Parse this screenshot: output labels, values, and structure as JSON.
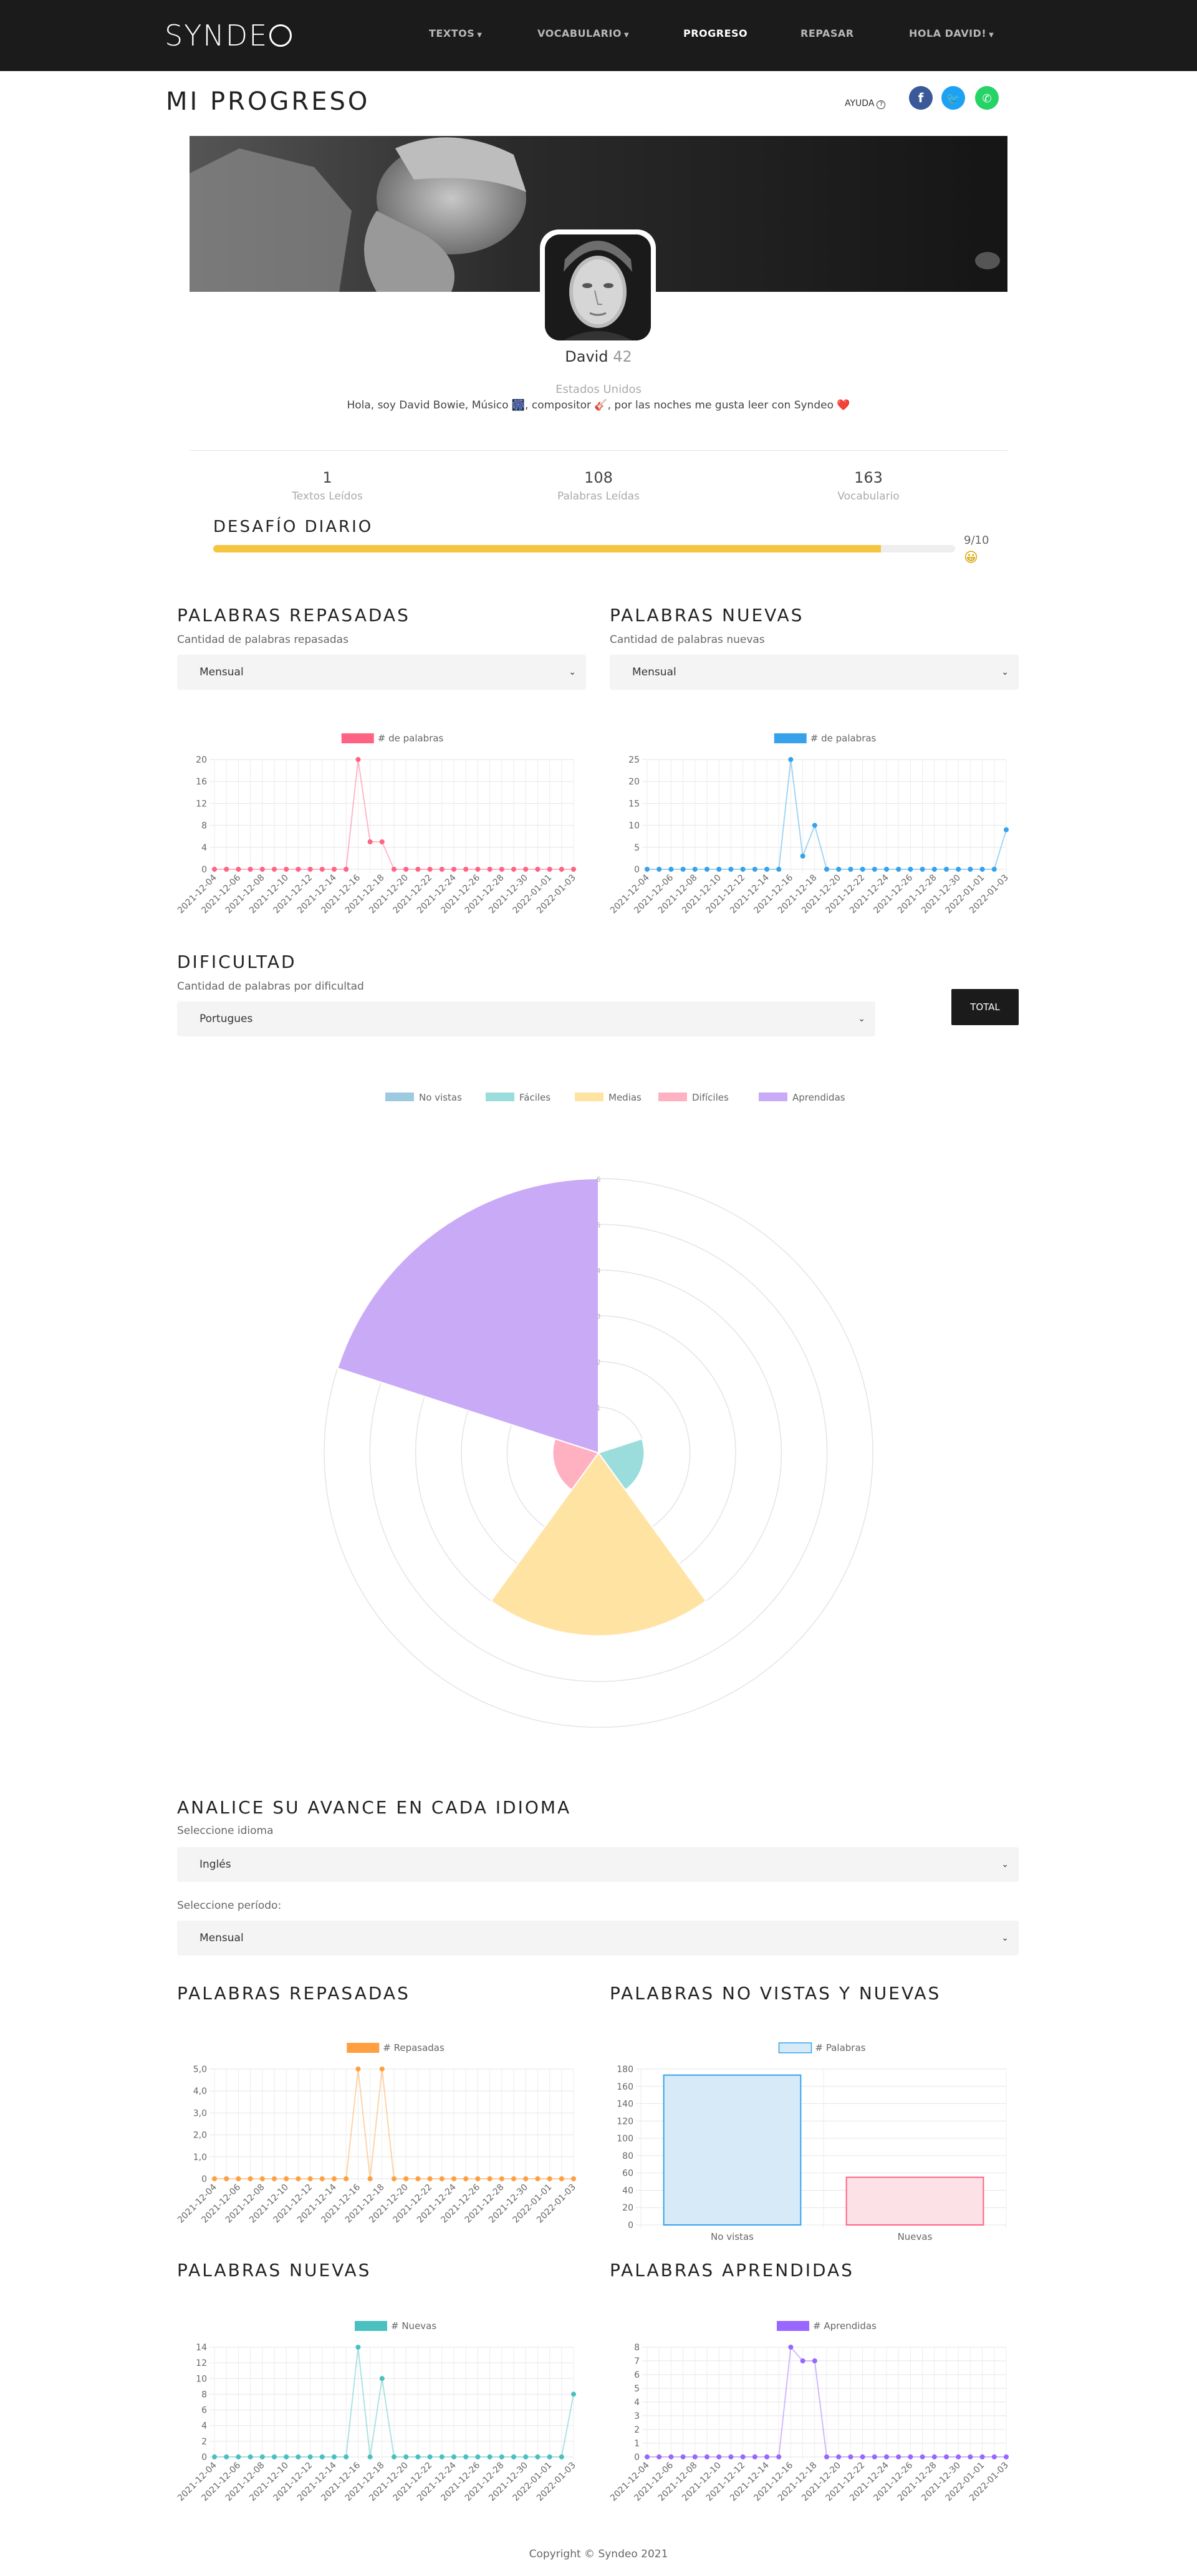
{
  "nav": {
    "brand": "SYNDE",
    "items": [
      {
        "label": "TEXTOS",
        "dropdown": true
      },
      {
        "label": "VOCABULARIO",
        "dropdown": true
      },
      {
        "label": "PROGRESO",
        "dropdown": false,
        "active": true
      },
      {
        "label": "REPASAR",
        "dropdown": false
      },
      {
        "label": "HOLA DAVID!",
        "dropdown": true
      }
    ]
  },
  "header": {
    "title": "MI PROGRESO",
    "help": "AYUDA"
  },
  "social": [
    {
      "name": "facebook",
      "glyph": "f",
      "color": "#3b5998"
    },
    {
      "name": "twitter",
      "glyph": "t",
      "color": "#1da1f2"
    },
    {
      "name": "whatsapp",
      "glyph": "w",
      "color": "#25d366"
    }
  ],
  "profile": {
    "name": "David",
    "age": "42",
    "country": "Estados Unidos",
    "bio": "Hola, soy David Bowie, Músico 🎆, compositor 🎸, por las noches me gusta leer con Syndeo ❤️"
  },
  "stats": [
    {
      "value": "1",
      "label": "Textos Leídos"
    },
    {
      "value": "108",
      "label": "Palabras Leídas"
    },
    {
      "value": "163",
      "label": "Vocabulario"
    }
  ],
  "challenge": {
    "title": "DESAFÍO DIARIO",
    "text": "9/10",
    "fraction": 0.9,
    "emoji": "😀"
  },
  "repasadas": {
    "title": "PALABRAS REPASADAS",
    "subtitle": "Cantidad de palabras repasadas",
    "select": "Mensual"
  },
  "nuevas": {
    "title": "PALABRAS NUEVAS",
    "subtitle": "Cantidad de palabras nuevas",
    "select": "Mensual"
  },
  "dificultad": {
    "title": "DIFICULTAD",
    "subtitle": "Cantidad de palabras por dificultad",
    "select": "Portugues",
    "button": "TOTAL"
  },
  "idioma": {
    "title": "ANALICE SU AVANCE EN CADA IDIOMA",
    "language_label": "Seleccione idioma",
    "language": "Inglés",
    "period_label": "Seleccione período:",
    "period": "Mensual"
  },
  "sections2": {
    "repasadas": "PALABRAS REPASADAS",
    "novistas": "PALABRAS NO VISTAS Y NUEVAS",
    "nuevas": "PALABRAS NUEVAS",
    "aprendidas": "PALABRAS APRENDIDAS"
  },
  "footer": "Copyright © Syndeo 2021",
  "chart_data": [
    {
      "id": "c1",
      "type": "line",
      "series": [
        {
          "name": "# de palabras",
          "color": "#ff6384",
          "values": [
            0,
            0,
            0,
            0,
            0,
            0,
            0,
            0,
            0,
            0,
            0,
            0,
            20,
            5,
            5,
            0,
            0,
            0,
            0,
            0,
            0,
            0,
            0,
            0,
            0,
            0,
            0,
            0,
            0,
            0,
            0
          ]
        }
      ],
      "x_tick_labels": [
        "2021-12-04",
        "2021-12-06",
        "2021-12-08",
        "2021-12-10",
        "2021-12-12",
        "2021-12-14",
        "2021-12-16",
        "2021-12-18",
        "2021-12-20",
        "2021-12-22",
        "2021-12-24",
        "2021-12-26",
        "2021-12-28",
        "2021-12-30",
        "2022-01-01",
        "2022-01-03"
      ],
      "y_ticks": [
        "0",
        "4",
        "8",
        "12",
        "16",
        "20"
      ],
      "ylim": [
        0,
        20
      ]
    },
    {
      "id": "c2",
      "type": "line",
      "series": [
        {
          "name": "# de palabras",
          "color": "#36a2eb",
          "values": [
            0,
            0,
            0,
            0,
            0,
            0,
            0,
            0,
            0,
            0,
            0,
            0,
            25,
            3,
            10,
            0,
            0,
            0,
            0,
            0,
            0,
            0,
            0,
            0,
            0,
            0,
            0,
            0,
            0,
            0,
            9
          ]
        }
      ],
      "x_tick_labels": [
        "2021-12-04",
        "2021-12-06",
        "2021-12-08",
        "2021-12-10",
        "2021-12-12",
        "2021-12-14",
        "2021-12-16",
        "2021-12-18",
        "2021-12-20",
        "2021-12-22",
        "2021-12-24",
        "2021-12-26",
        "2021-12-28",
        "2021-12-30",
        "2022-01-01",
        "2022-01-03"
      ],
      "y_ticks": [
        "0",
        "5",
        "10",
        "15",
        "20",
        "25"
      ],
      "ylim": [
        0,
        25
      ]
    },
    {
      "id": "c3",
      "type": "polarArea",
      "categories": [
        "No vistas",
        "Fáciles",
        "Medias",
        "Difíciles",
        "Aprendidas"
      ],
      "values": [
        0,
        1,
        4,
        1,
        6
      ],
      "colors": [
        "#9ecae1",
        "#9bdcdc",
        "#ffe3a3",
        "#ffb1c1",
        "#c9aaf7"
      ],
      "rmax": 6
    },
    {
      "id": "c4",
      "type": "line",
      "series": [
        {
          "name": "# Repasadas",
          "color": "#ff9f40",
          "values": [
            0,
            0,
            0,
            0,
            0,
            0,
            0,
            0,
            0,
            0,
            0,
            0,
            5,
            0,
            5,
            0,
            0,
            0,
            0,
            0,
            0,
            0,
            0,
            0,
            0,
            0,
            0,
            0,
            0,
            0,
            0
          ]
        }
      ],
      "x_tick_labels": [
        "2021-12-04",
        "2021-12-06",
        "2021-12-08",
        "2021-12-10",
        "2021-12-12",
        "2021-12-14",
        "2021-12-16",
        "2021-12-18",
        "2021-12-20",
        "2021-12-22",
        "2021-12-24",
        "2021-12-26",
        "2021-12-28",
        "2021-12-30",
        "2022-01-01",
        "2022-01-03"
      ],
      "y_ticks": [
        "0",
        "1,0",
        "2,0",
        "3,0",
        "4,0",
        "5,0"
      ],
      "ylim": [
        0,
        5
      ]
    },
    {
      "id": "c5",
      "type": "bar",
      "series": [
        {
          "name": "# Palabras"
        }
      ],
      "categories": [
        "No vistas",
        "Nuevas"
      ],
      "values": [
        173,
        55
      ],
      "fill": [
        "#d6eaf8",
        "#fce1e6"
      ],
      "stroke": [
        "#36a2eb",
        "#ff6384"
      ],
      "y_ticks": [
        "0",
        "20",
        "40",
        "60",
        "80",
        "100",
        "120",
        "140",
        "160",
        "180"
      ],
      "ylim": [
        0,
        180
      ]
    },
    {
      "id": "c6",
      "type": "line",
      "series": [
        {
          "name": "# Nuevas",
          "color": "#4bc0c0",
          "values": [
            0,
            0,
            0,
            0,
            0,
            0,
            0,
            0,
            0,
            0,
            0,
            0,
            14,
            0,
            10,
            0,
            0,
            0,
            0,
            0,
            0,
            0,
            0,
            0,
            0,
            0,
            0,
            0,
            0,
            0,
            8
          ]
        }
      ],
      "x_tick_labels": [
        "2021-12-04",
        "2021-12-06",
        "2021-12-08",
        "2021-12-10",
        "2021-12-12",
        "2021-12-14",
        "2021-12-16",
        "2021-12-18",
        "2021-12-20",
        "2021-12-22",
        "2021-12-24",
        "2021-12-26",
        "2021-12-28",
        "2021-12-30",
        "2022-01-01",
        "2022-01-03"
      ],
      "y_ticks": [
        "0",
        "2",
        "4",
        "6",
        "8",
        "10",
        "12",
        "14"
      ],
      "ylim": [
        0,
        14
      ]
    },
    {
      "id": "c7",
      "type": "line",
      "series": [
        {
          "name": "# Aprendidas",
          "color": "#9966ff",
          "values": [
            0,
            0,
            0,
            0,
            0,
            0,
            0,
            0,
            0,
            0,
            0,
            0,
            8,
            7,
            7,
            0,
            0,
            0,
            0,
            0,
            0,
            0,
            0,
            0,
            0,
            0,
            0,
            0,
            0,
            0,
            0
          ]
        }
      ],
      "x_tick_labels": [
        "2021-12-04",
        "2021-12-06",
        "2021-12-08",
        "2021-12-10",
        "2021-12-12",
        "2021-12-14",
        "2021-12-16",
        "2021-12-18",
        "2021-12-20",
        "2021-12-22",
        "2021-12-24",
        "2021-12-26",
        "2021-12-28",
        "2021-12-30",
        "2022-01-01",
        "2022-01-03"
      ],
      "y_ticks": [
        "0",
        "1",
        "2",
        "3",
        "4",
        "5",
        "6",
        "7",
        "8"
      ],
      "ylim": [
        0,
        8
      ]
    }
  ]
}
